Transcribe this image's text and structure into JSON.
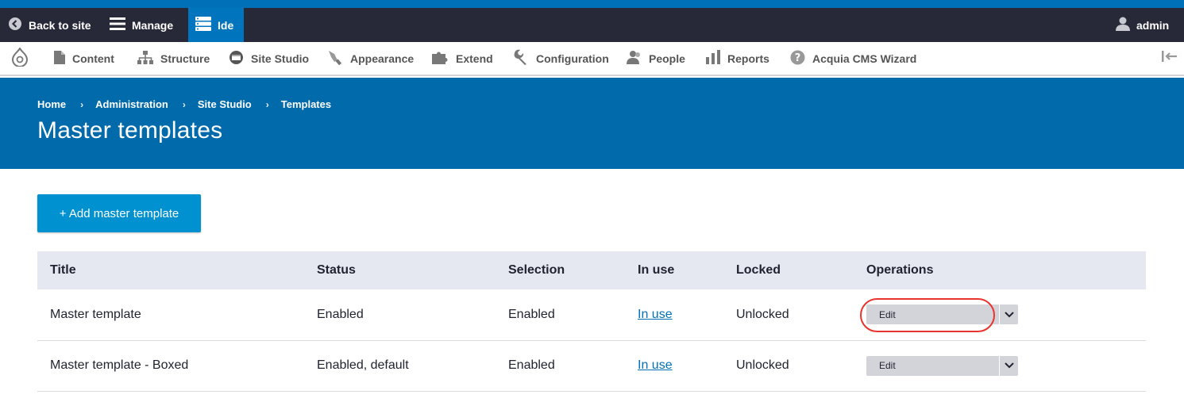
{
  "toolbar": {
    "back_label": "Back to site",
    "manage_label": "Manage",
    "ide_label": "Ide",
    "user_label": "admin"
  },
  "tray": {
    "items": [
      {
        "label": "Content",
        "icon": "file-icon"
      },
      {
        "label": "Structure",
        "icon": "sitemap-icon"
      },
      {
        "label": "Site Studio",
        "icon": "site-studio-icon"
      },
      {
        "label": "Appearance",
        "icon": "paintbrush-icon"
      },
      {
        "label": "Extend",
        "icon": "puzzle-icon"
      },
      {
        "label": "Configuration",
        "icon": "wrench-icon"
      },
      {
        "label": "People",
        "icon": "people-icon"
      },
      {
        "label": "Reports",
        "icon": "bar-chart-icon"
      },
      {
        "label": "Acquia CMS Wizard",
        "icon": "question-icon"
      }
    ]
  },
  "breadcrumb": [
    "Home",
    "Administration",
    "Site Studio",
    "Templates"
  ],
  "page_title": "Master templates",
  "add_button_label": "+ Add master template",
  "table": {
    "headers": [
      "Title",
      "Status",
      "Selection",
      "In use",
      "Locked",
      "Operations"
    ],
    "rows": [
      {
        "title": "Master template",
        "status": "Enabled",
        "selection": "Enabled",
        "in_use": "In use",
        "locked": "Unlocked",
        "operation": "Edit"
      },
      {
        "title": "Master template - Boxed",
        "status": "Enabled, default",
        "selection": "Enabled",
        "in_use": "In use",
        "locked": "Unlocked",
        "operation": "Edit"
      }
    ]
  },
  "colors": {
    "toolbar_bg": "#272938",
    "accent_blue": "#0071b8",
    "header_bg": "#006aaa",
    "button_bg": "#0092d0",
    "highlight": "#e8332e"
  }
}
